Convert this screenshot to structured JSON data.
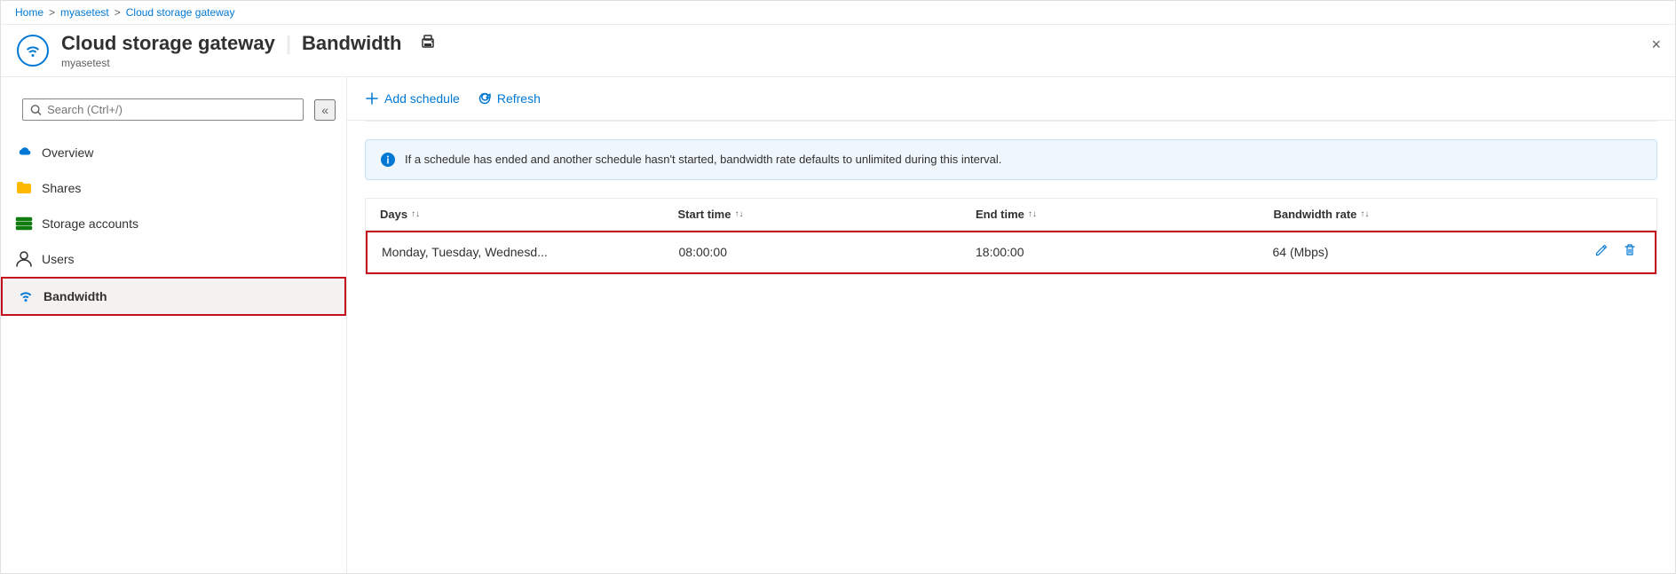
{
  "breadcrumb": {
    "home": "Home",
    "sep1": ">",
    "device": "myasetest",
    "sep2": ">",
    "current": "Cloud storage gateway"
  },
  "header": {
    "title": "Cloud storage gateway",
    "divider": "|",
    "section": "Bandwidth",
    "subtitle": "myasetest",
    "print_label": "print",
    "close_label": "×"
  },
  "sidebar": {
    "search_placeholder": "Search (Ctrl+/)",
    "collapse_label": "«",
    "nav_items": [
      {
        "id": "overview",
        "label": "Overview",
        "icon": "cloud"
      },
      {
        "id": "shares",
        "label": "Shares",
        "icon": "folder"
      },
      {
        "id": "storage-accounts",
        "label": "Storage accounts",
        "icon": "storage"
      },
      {
        "id": "users",
        "label": "Users",
        "icon": "user"
      },
      {
        "id": "bandwidth",
        "label": "Bandwidth",
        "icon": "wifi",
        "active": true
      }
    ]
  },
  "toolbar": {
    "add_schedule_label": "Add schedule",
    "refresh_label": "Refresh"
  },
  "info_banner": {
    "text": "If a schedule has ended and another schedule hasn't started, bandwidth rate defaults to unlimited during this interval."
  },
  "table": {
    "headers": [
      {
        "label": "Days"
      },
      {
        "label": "Start time"
      },
      {
        "label": "End time"
      },
      {
        "label": "Bandwidth rate"
      }
    ],
    "rows": [
      {
        "days": "Monday, Tuesday, Wednesd...",
        "start_time": "08:00:00",
        "end_time": "18:00:00",
        "bandwidth_rate": "64 (Mbps)"
      }
    ]
  },
  "icons": {
    "search": "🔍",
    "info": "ℹ",
    "sort_up_down": "↑↓",
    "edit": "✏",
    "delete": "🗑",
    "add": "+",
    "refresh": "↻",
    "print": "⊟",
    "close": "✕"
  },
  "colors": {
    "blue": "#0078d4",
    "red_border": "#c50f1f",
    "light_bg": "#f3f2f1",
    "info_bg": "#eff6fc"
  }
}
